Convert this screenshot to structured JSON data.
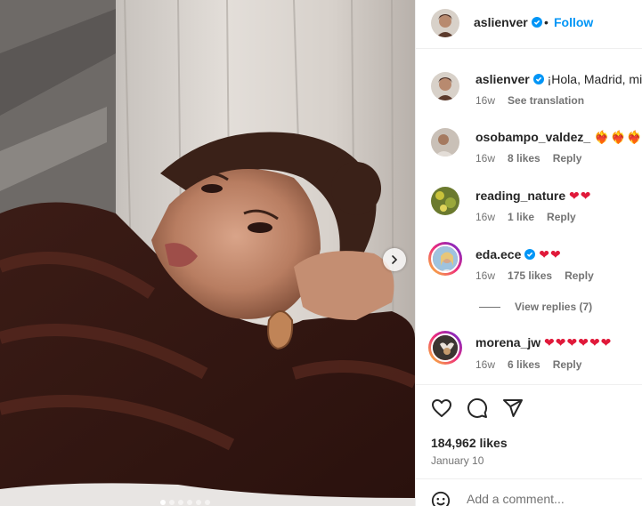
{
  "colors": {
    "link_blue": "#0095f6",
    "verified_blue": "#0095f6",
    "heart_red": "#e0193a",
    "secondary_text": "#737373"
  },
  "header": {
    "username": "aslienver",
    "separator": "•",
    "follow_label": "Follow"
  },
  "caption": {
    "username": "aslienver",
    "text": "¡Hola, Madrid, mi a",
    "age": "16w",
    "translate_label": "See translation"
  },
  "comments": [
    {
      "username": "osobampo_valdez_",
      "text": "❤️‍🔥❤️‍🔥❤️‍🔥❤️‍🔥",
      "age": "16w",
      "likes": "8 likes",
      "reply": "Reply"
    },
    {
      "username": "reading_nature",
      "text": "❤❤",
      "age": "16w",
      "likes": "1 like",
      "reply": "Reply"
    },
    {
      "username": "eda.ece",
      "text": "❤❤",
      "age": "16w",
      "likes": "175 likes",
      "reply": "Reply",
      "replies_label": "View replies (7)"
    },
    {
      "username": "morena_jw",
      "text": "❤❤❤❤❤❤",
      "age": "16w",
      "likes": "6 likes",
      "reply": "Reply"
    }
  ],
  "post": {
    "likes": "184,962 likes",
    "date": "January 10",
    "comment_placeholder": "Add a comment..."
  },
  "icons": [
    "next-arrow-icon",
    "verified-badge-icon",
    "heart-icon",
    "comment-icon",
    "share-icon",
    "emoji-icon"
  ]
}
